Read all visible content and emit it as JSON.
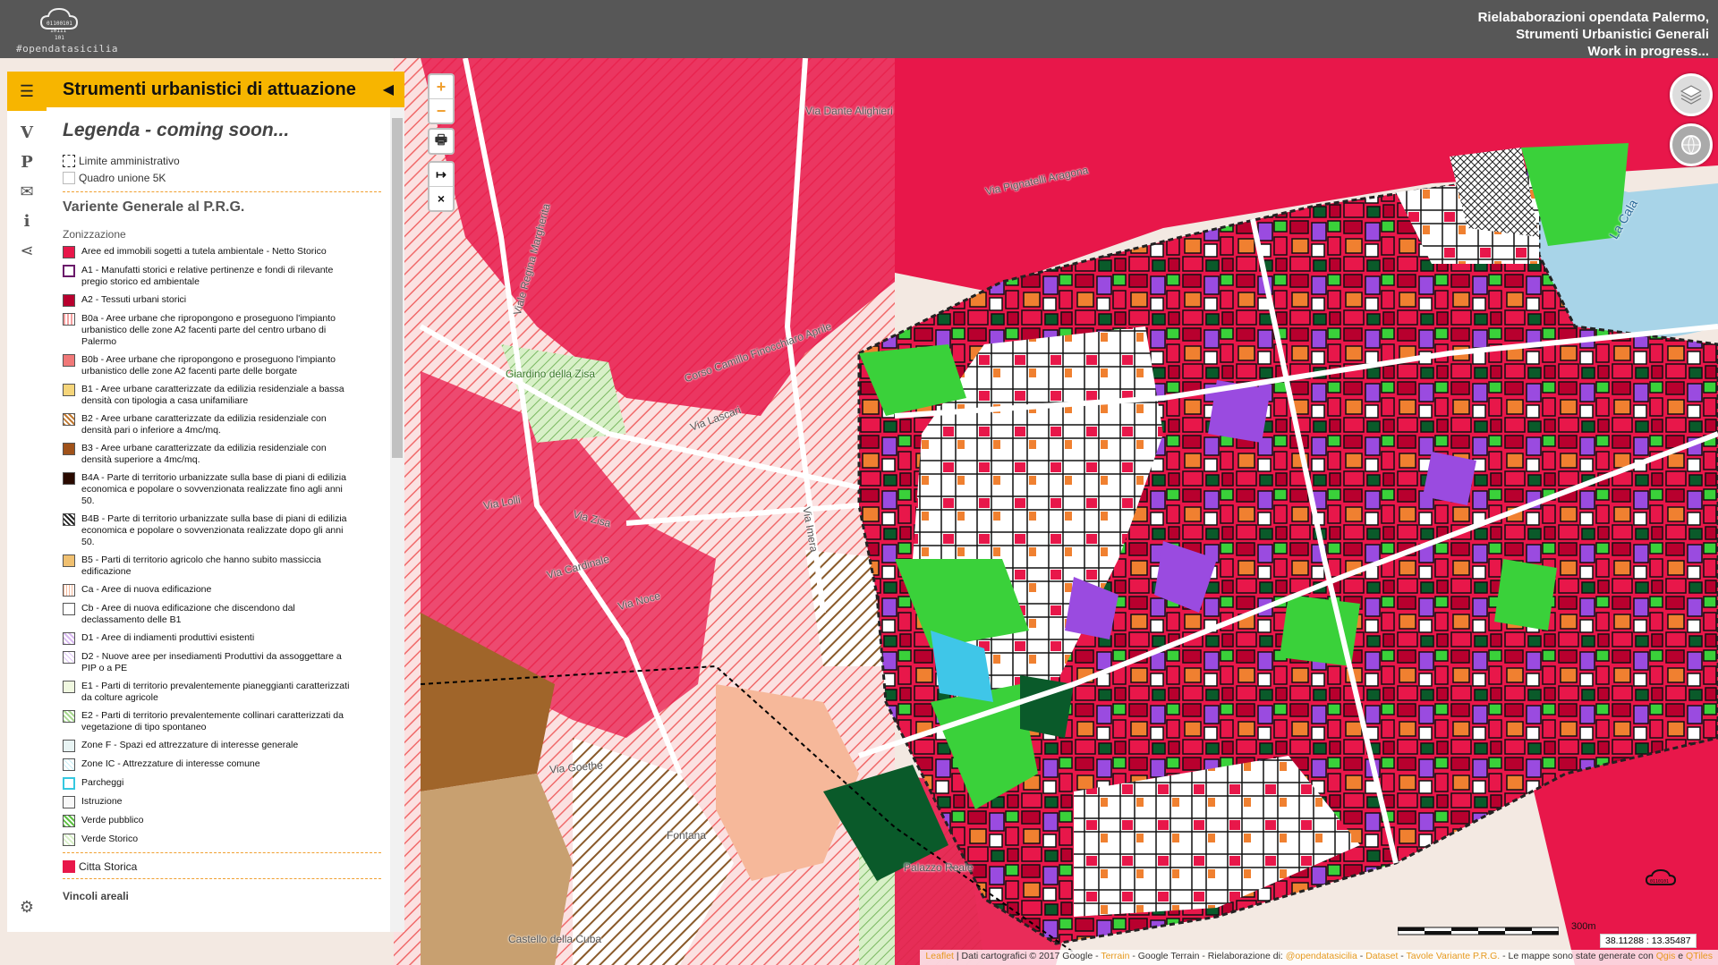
{
  "header": {
    "logo_text": "#opendatasicilia",
    "title_lines": [
      "Rielababorazioni opendata Palermo,",
      "Strumenti Urbanistici Generali",
      "Work in progress..."
    ]
  },
  "panel": {
    "title": "Strumenti urbanistici di attuazione",
    "legend_heading": "Legenda - coming soon...",
    "base_layers": [
      {
        "label": "Limite amministrativo",
        "color": "#ffffff",
        "style": "dashed"
      },
      {
        "label": "Quadro unione 5K",
        "color": "#ffffff",
        "style": "plain"
      }
    ],
    "section_title": "Variente Generale al P.R.G.",
    "zonizzazione_label": "Zonizzazione",
    "legend_items": [
      {
        "label": "Aree ed immobili sogetti a tutela ambientale - Netto Storico",
        "color": "#e8174a",
        "style": "solid"
      },
      {
        "label": "A1 - Manufatti storici e relative pertinenze e fondi di rilevante pregio storico ed ambientale",
        "color": "#ffffff",
        "style": "outline-purple"
      },
      {
        "label": "A2 - Tessuti urbani storici",
        "color": "#b8002e",
        "style": "solid"
      },
      {
        "label": "B0a - Aree urbane che ripropongono e proseguono l'impianto urbanistico delle zone A2 facenti parte del centro urbano di Palermo",
        "color": "#f4a0a0",
        "style": "hatch-v"
      },
      {
        "label": "B0b - Aree urbane che ripropongono e proseguono l'impianto urbanistico delle zone A2 facenti parte delle borgate",
        "color": "#f07878",
        "style": "solid"
      },
      {
        "label": "B1 - Aree urbane caratterizzate da edilizia residenziale a bassa densità con tipologia a casa unifamiliare",
        "color": "#f5d57a",
        "style": "solid"
      },
      {
        "label": "B2 - Aree urbane caratterizzate da edilizia residenziale con densità pari o inferiore a 4mc/mq.",
        "color": "#c07830",
        "style": "hatch-d"
      },
      {
        "label": "B3 - Aree urbane caratterizzate da edilizia residenziale con densità superiore a 4mc/mq.",
        "color": "#a0521a",
        "style": "solid"
      },
      {
        "label": "B4A - Parte di territorio urbanizzate sulla base di piani di edilizia economica e popolare o sovvenzionata realizzate fino agli anni 50.",
        "color": "#2a0a00",
        "style": "solid"
      },
      {
        "label": "B4B - Parte di territorio urbanizzate sulla base di piani di edilizia economica e popolare o sovvenzionata realizzate dopo gli anni 50.",
        "color": "#222222",
        "style": "hatch-d"
      },
      {
        "label": "B5 - Parti di territorio agricolo che hanno subito massiccia edificazione",
        "color": "#f0c070",
        "style": "solid"
      },
      {
        "label": "Ca - Aree di nuova edificazione",
        "color": "#f6b89a",
        "style": "hatch-g"
      },
      {
        "label": "Cb - Aree di nuova edificazione che discendono dal declassamento delle B1",
        "color": "#ffffff",
        "style": "plain"
      },
      {
        "label": "D1 - Aree di indiamenti produttivi esistenti",
        "color": "#d8b8f0",
        "style": "hatch-d"
      },
      {
        "label": "D2 - Nuove aree per insediamenti Produttivi da assoggettare a PIP o a PE",
        "color": "#e0c8f8",
        "style": "hatch-x"
      },
      {
        "label": "E1 - Parti di territorio prevalentemente pianeggianti caratterizzati da colture agricole",
        "color": "#f0f8e0",
        "style": "plain"
      },
      {
        "label": "E2 - Parti di territorio prevalentemente collinari caratterizzati da vegetazione di tipo spontaneo",
        "color": "#a8d890",
        "style": "hatch-d"
      },
      {
        "label": "Zone F - Spazi ed attrezzature di interesse generale",
        "color": "#e8f4f4",
        "style": "plain"
      },
      {
        "label": "Zone IC - Attrezzature di interesse comune",
        "color": "#c8f0f8",
        "style": "hatch-x"
      },
      {
        "label": "Parcheggi",
        "color": "#ffffff",
        "style": "outline-cyan"
      },
      {
        "label": "Istruzione",
        "color": "#f8f8f8",
        "style": "plain"
      },
      {
        "label": "Verde pubblico",
        "color": "#5cc040",
        "style": "hatch-d"
      },
      {
        "label": "Verde Storico",
        "color": "#d8f0c8",
        "style": "hatch-d"
      }
    ],
    "citta_storica": {
      "label": "Citta Storica",
      "color": "#e8174a"
    },
    "vincoli_label": "Vincoli areali"
  },
  "sidebar_tabs": [
    {
      "name": "tab-menu",
      "glyph": "☰"
    },
    {
      "name": "tab-v",
      "glyph": "V"
    },
    {
      "name": "tab-p",
      "glyph": "P"
    },
    {
      "name": "tab-mail",
      "glyph": "✉"
    },
    {
      "name": "tab-info",
      "glyph": "i"
    },
    {
      "name": "tab-share",
      "glyph": "⋖"
    }
  ],
  "settings_glyph": "⚙",
  "map": {
    "zoom_in": "+",
    "zoom_out": "−",
    "print_glyph": "🖶",
    "measure_glyph": "↦",
    "clear_glyph": "×",
    "street_labels": [
      "Via Dante Alighieri",
      "Corso Camillo Finocchiaro Aprile",
      "Via Lascari",
      "Giardino della Zisa",
      "Via Imera",
      "Via Zisa",
      "Via Cardinale",
      "Viale Regina Margherita",
      "Via Pignatelli Aragona",
      "La Cala",
      "Palazzo Reale",
      "Castello della Cuba",
      "Fontana",
      "Via Goethe",
      "Via Lolli",
      "Via Noce"
    ],
    "scale_label": "300m",
    "coords": "38.11288 : 13.35487",
    "attribution": {
      "leaflet": "Leaflet",
      "text1": " | Dati cartografici © 2017 Google - ",
      "terrain": "Terrain",
      "text2": " - Google Terrain - Rielaborazione di: ",
      "ods": "@opendatasicilia",
      "text3": " - ",
      "dataset": "Dataset",
      "text4": " - ",
      "tavole": "Tavole Variante P.R.G.",
      "text5": " - Le mappe sono state generate con ",
      "qgis": "Qgis",
      "text6": " e ",
      "qtiles": "QTiles"
    }
  },
  "colors": {
    "accent": "#f7b500",
    "header_bg": "#575757",
    "red": "#e8174a",
    "dark_red": "#b8002e",
    "green": "#3ad13a",
    "dark_green": "#0a5a2a",
    "purple": "#9a4be0",
    "brown": "#a0652a",
    "orange": "#f08030"
  }
}
